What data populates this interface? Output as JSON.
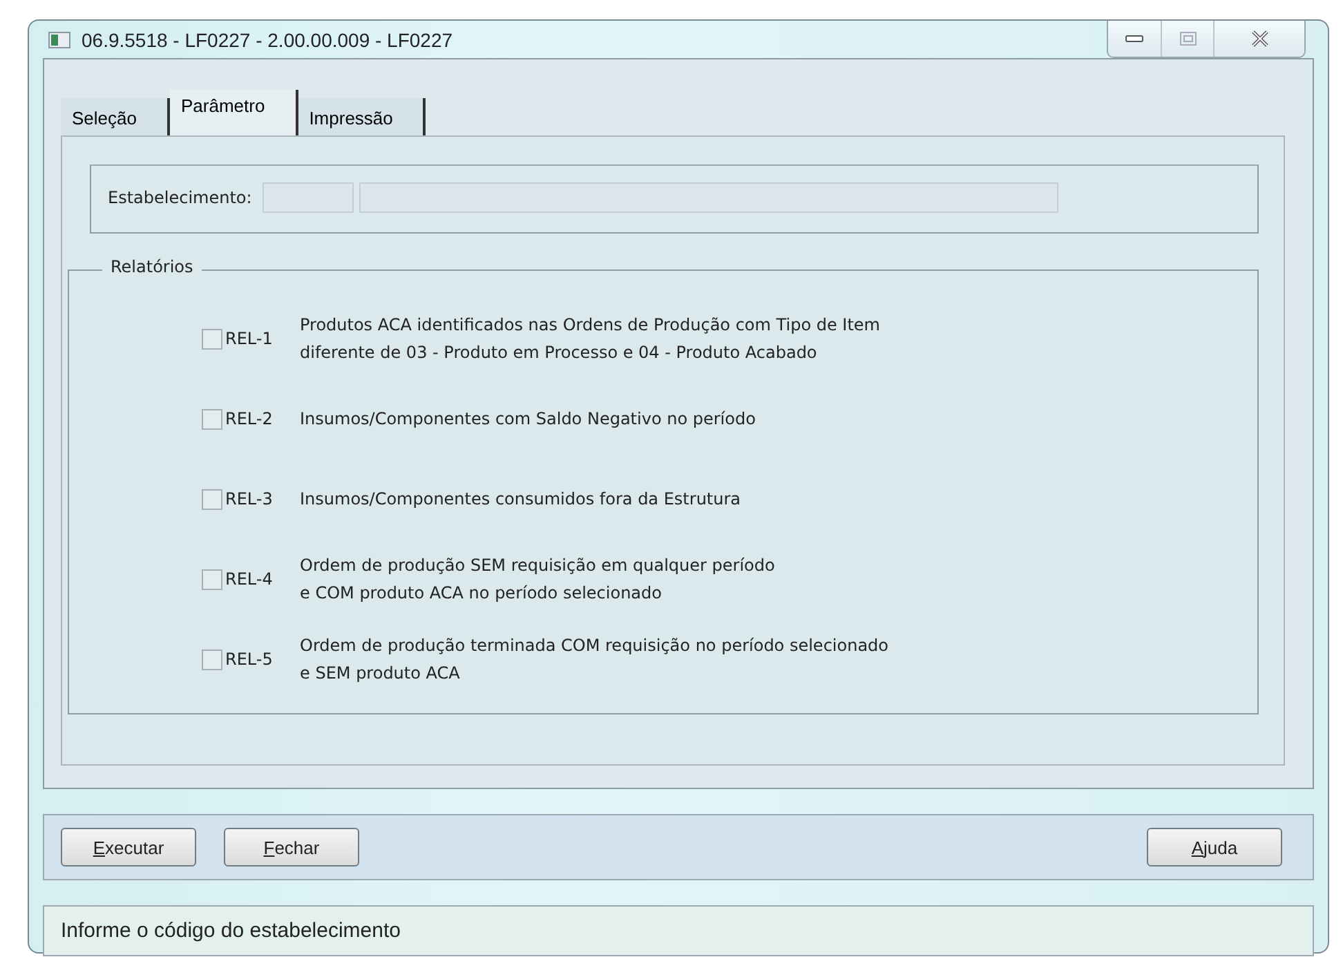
{
  "window": {
    "title": "06.9.5518 - LF0227 - 2.00.00.009 - LF0227"
  },
  "tabs": [
    {
      "label": "Seleção",
      "selected": false
    },
    {
      "label": "Parâmetro",
      "selected": true
    },
    {
      "label": "Impressão",
      "selected": false
    }
  ],
  "estabelecimento": {
    "label": "Estabelecimento:"
  },
  "relatorios": {
    "title": "Relatórios",
    "items": [
      {
        "code": "REL-1",
        "description": "Produtos ACA identificados nas Ordens de Produção com Tipo de Item\ndiferente de 03 - Produto em Processo e 04 - Produto Acabado",
        "checked": false
      },
      {
        "code": "REL-2",
        "description": "Insumos/Componentes com Saldo Negativo no período",
        "checked": false
      },
      {
        "code": "REL-3",
        "description": "Insumos/Componentes consumidos fora da Estrutura",
        "checked": false
      },
      {
        "code": "REL-4",
        "description": "Ordem de produção SEM requisição em qualquer período\ne COM produto ACA no período selecionado",
        "checked": false
      },
      {
        "code": "REL-5",
        "description": "Ordem de produção terminada COM requisição no período selecionado\ne SEM produto ACA",
        "checked": false
      }
    ]
  },
  "buttons_left": [
    "Executar",
    "Fechar"
  ],
  "buttons_right": [
    "Ajuda"
  ],
  "status_bar": "Informe o código do estabelecimento"
}
